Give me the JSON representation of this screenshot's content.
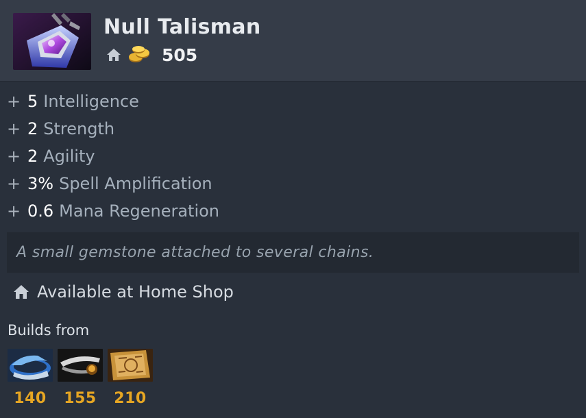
{
  "item": {
    "name": "Null Talisman",
    "icon": "null-talisman-icon",
    "cost": "505"
  },
  "stats": [
    {
      "plus": "+",
      "value": "5",
      "name": "Intelligence"
    },
    {
      "plus": "+",
      "value": "2",
      "name": "Strength"
    },
    {
      "plus": "+",
      "value": "2",
      "name": "Agility"
    },
    {
      "plus": "+",
      "value": "3%",
      "name": "Spell Amplification"
    },
    {
      "plus": "+",
      "value": "0.6",
      "name": "Mana Regeneration"
    }
  ],
  "lore": "A small gemstone attached to several chains.",
  "availability": "Available at Home Shop",
  "builds_label": "Builds from",
  "components": [
    {
      "icon": "circlet-icon",
      "cost": "140"
    },
    {
      "icon": "ring-icon",
      "cost": "155"
    },
    {
      "icon": "recipe-scroll-icon",
      "cost": "210"
    }
  ],
  "colors": {
    "background": "#29303b",
    "header": "#353c48",
    "gold": "#e6a623",
    "stat_value": "#ffffff",
    "stat_name": "#a5b0bc"
  }
}
